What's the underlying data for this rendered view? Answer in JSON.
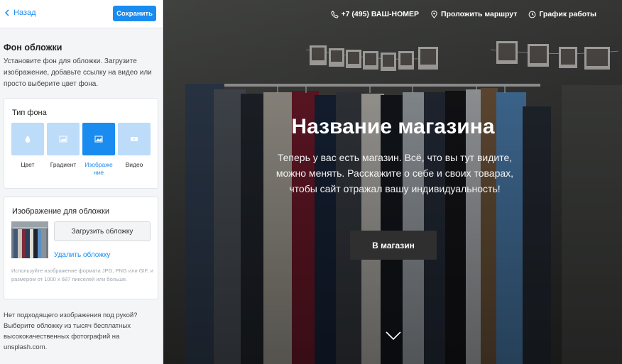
{
  "header": {
    "back_label": "Назад",
    "save_label": "Сохранить"
  },
  "section": {
    "title": "Фон обложки",
    "description": "Установите фон для обложки. Загрузите изображение, добавьте ссылку на видео или просто выберите цвет фона."
  },
  "bg_type": {
    "title": "Тип фона",
    "options": [
      {
        "label": "Цвет",
        "icon": "drop-icon"
      },
      {
        "label": "Градиент",
        "icon": "gradient-icon"
      },
      {
        "label": "Изображе ние",
        "icon": "image-icon",
        "selected": true
      },
      {
        "label": "Видео",
        "icon": "video-icon"
      }
    ]
  },
  "cover_image": {
    "title": "Изображение для обложки",
    "upload_label": "Загрузить обложку",
    "remove_label": "Удалить обложку",
    "hint": "Используйте изображение формата JPG, PNG или GIF, и размером от 1000 x 687 пикселей или больше."
  },
  "bottom_note": "Нет подходящего изображения под рукой? Выберите обложку из тысяч бесплатных высококачественных фотографий на unsplash.com.",
  "preview": {
    "nav": {
      "phone": "+7 (495) ВАШ-НОМЕР",
      "route": "Проложить маршрут",
      "schedule": "График работы"
    },
    "title": "Название магазина",
    "text": "Теперь у вас есть магазин. Всё, что вы тут видите, можно менять. Расскажите о себе и своих товарах, чтобы сайт отражал вашу индивидуальность!",
    "cta": "В магазин"
  },
  "colors": {
    "accent": "#1a8cf0",
    "tile": "#bcdcf9",
    "cta_bg": "#2f2f2f"
  }
}
